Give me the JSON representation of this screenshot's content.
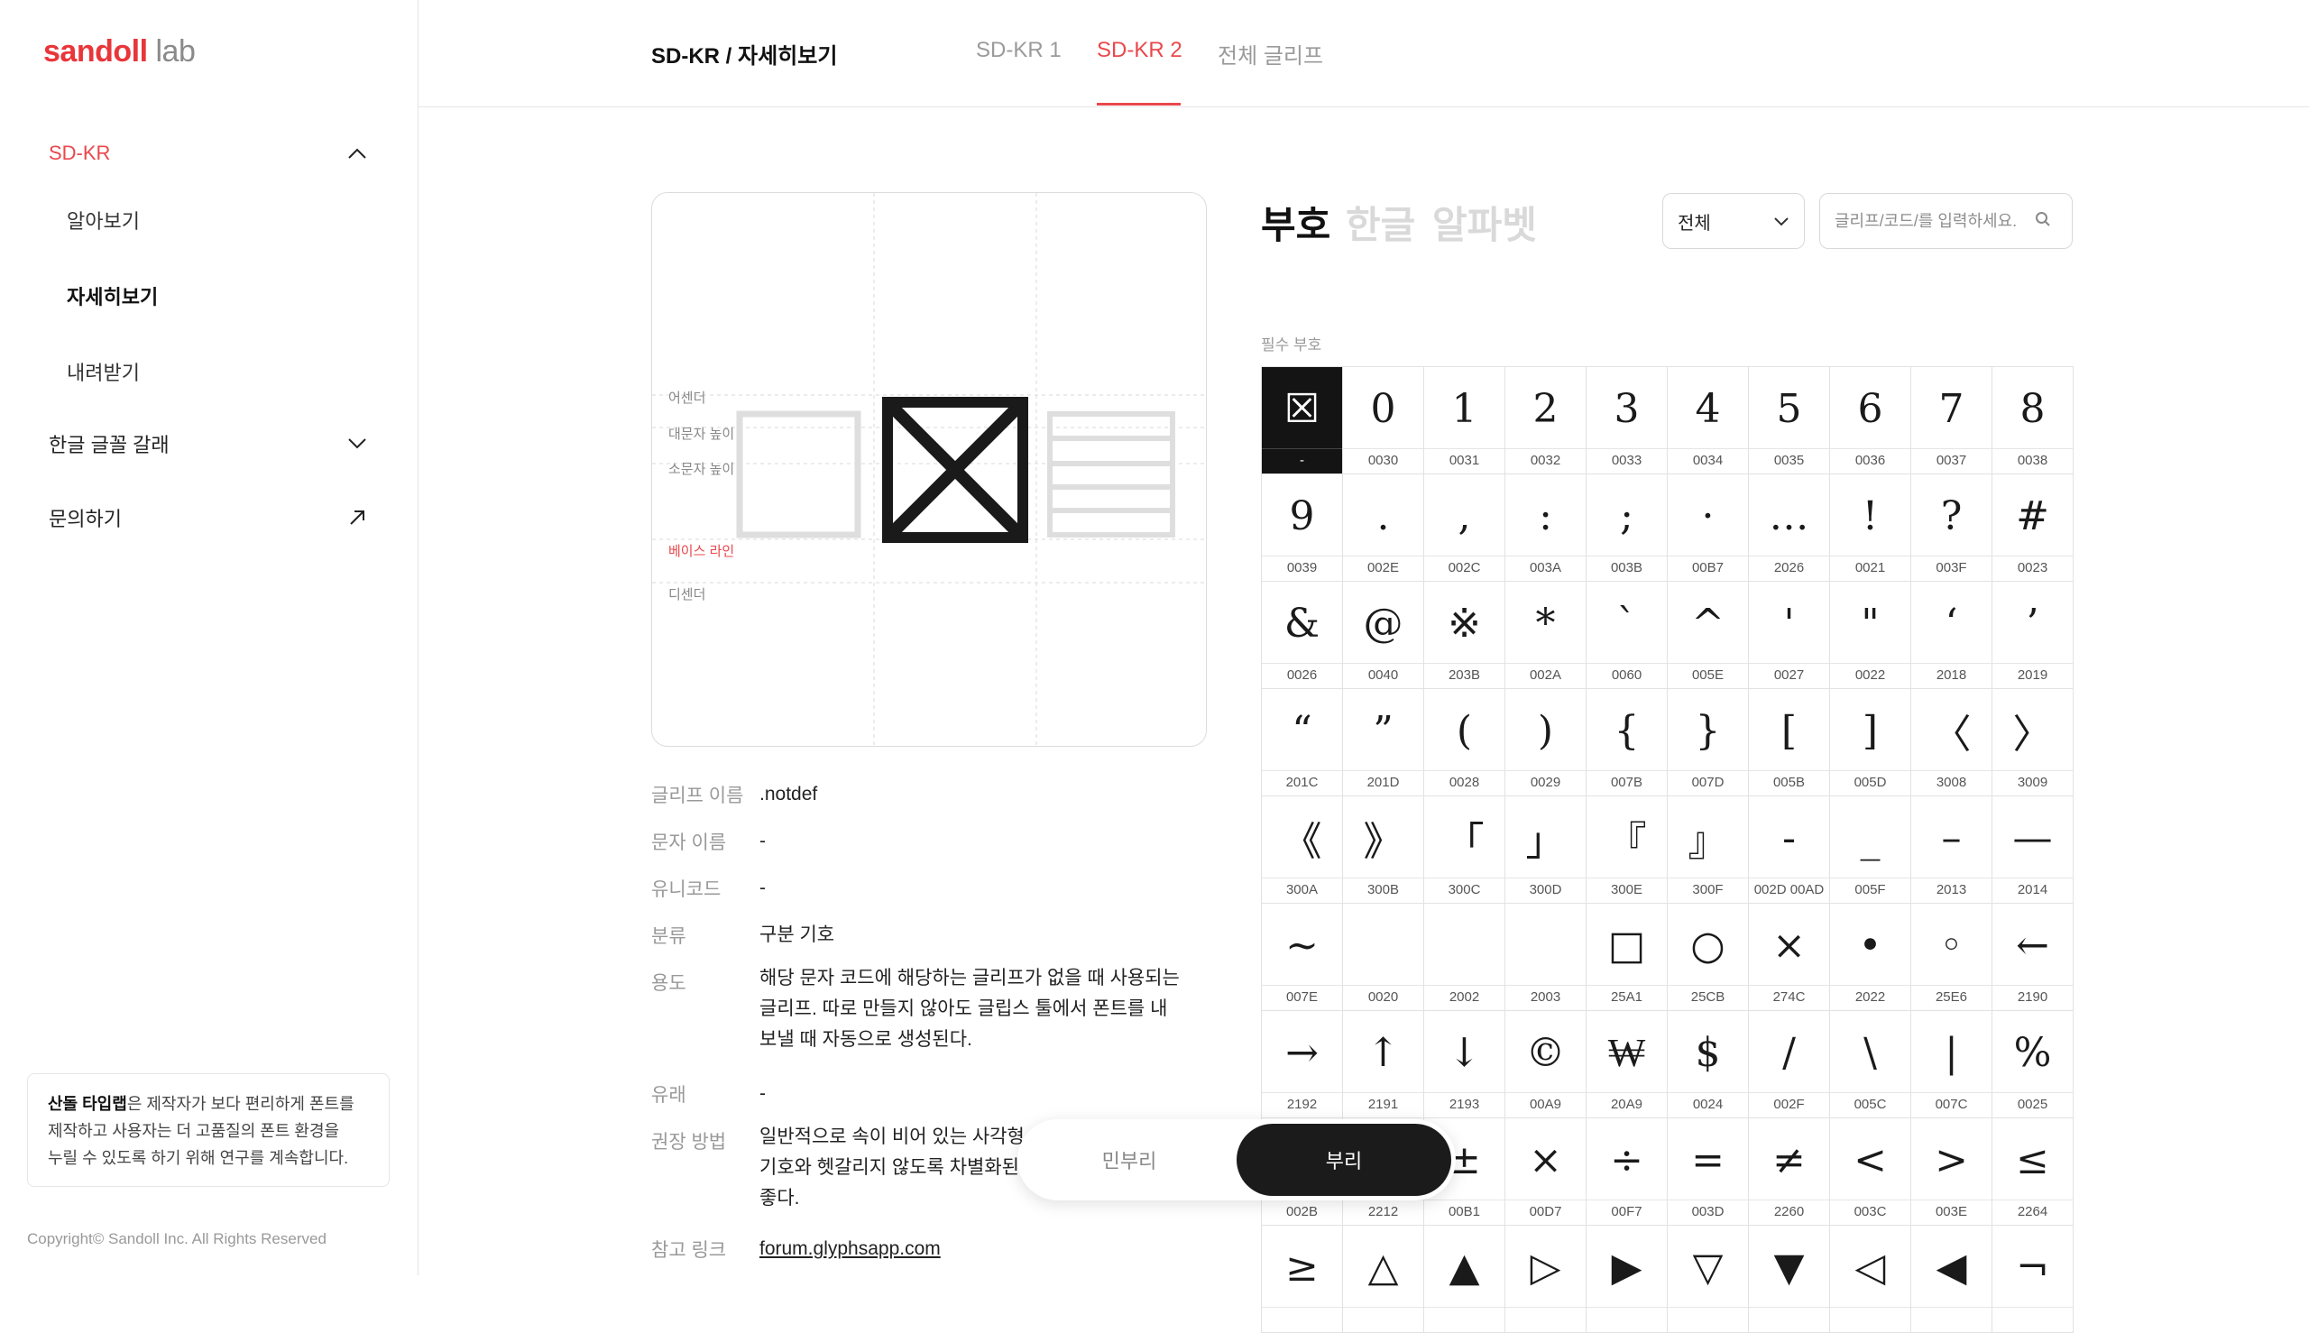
{
  "brand": {
    "name": "sandoll",
    "suffix": "lab",
    "accent": "#e9484c"
  },
  "sidebar": {
    "section": "SD-KR",
    "sub_items": [
      "알아보기",
      "자세히보기",
      "내려받기"
    ],
    "items": [
      "한글 글꼴 갈래",
      "문의하기"
    ],
    "notice_bold": "산돌 타입랩",
    "notice_line1": "은 제작자가 보다 편리하게 폰트를",
    "notice_line2": "제작하고 사용자는 더 고품질의 폰트 환경을",
    "notice_line3": "누릴 수 있도록 하기 위해 연구를 계속합니다.",
    "copyright": "Copyright© Sandoll Inc. All Rights Reserved"
  },
  "header": {
    "breadcrumb": "SD-KR / 자세히보기",
    "tabs": [
      "SD-KR 1",
      "SD-KR 2",
      "전체 글리프"
    ],
    "active_tab": "SD-KR 2"
  },
  "preview": {
    "metrics": [
      "어센더",
      "대문자 높이",
      "소문자 높이",
      "베이스 라인",
      "디센더"
    ]
  },
  "info": [
    {
      "key": "글리프 이름",
      "value": ".notdef"
    },
    {
      "key": "문자 이름",
      "value": "-"
    },
    {
      "key": "유니코드",
      "value": "-"
    },
    {
      "key": "분류",
      "value": "구분 기호"
    },
    {
      "key": "용도",
      "value": "해당 문자 코드에 해당하는 글리프가 없을 때 사용되는 글리프. 따로 만들지 않아도 글립스 툴에서 폰트를 내보낼 때 자동으로 생성된다."
    },
    {
      "key": "유래",
      "value": "-"
    },
    {
      "key": "권장 방법",
      "value": "일반적으로 속이 비어 있는 사각형 기호와 헷갈리지 않도록 차별화된 좋다."
    },
    {
      "key": "참고 링크",
      "value": "forum.glyphsapp.com"
    }
  ],
  "categories": [
    "부호",
    "한글",
    "알파벳"
  ],
  "filter": {
    "selected": "전체"
  },
  "search": {
    "placeholder": "글리프/코드/를 입력하세요."
  },
  "section_label": "필수 부호",
  "glyphs": [
    {
      "g": "☒",
      "c": "-"
    },
    {
      "g": "0",
      "c": "0030"
    },
    {
      "g": "1",
      "c": "0031"
    },
    {
      "g": "2",
      "c": "0032"
    },
    {
      "g": "3",
      "c": "0033"
    },
    {
      "g": "4",
      "c": "0034"
    },
    {
      "g": "5",
      "c": "0035"
    },
    {
      "g": "6",
      "c": "0036"
    },
    {
      "g": "7",
      "c": "0037"
    },
    {
      "g": "8",
      "c": "0038"
    },
    {
      "g": "9",
      "c": "0039"
    },
    {
      "g": ".",
      "c": "002E"
    },
    {
      "g": ",",
      "c": "002C"
    },
    {
      "g": ":",
      "c": "003A"
    },
    {
      "g": ";",
      "c": "003B"
    },
    {
      "g": "·",
      "c": "00B7"
    },
    {
      "g": "…",
      "c": "2026"
    },
    {
      "g": "!",
      "c": "0021"
    },
    {
      "g": "?",
      "c": "003F"
    },
    {
      "g": "#",
      "c": "0023"
    },
    {
      "g": "&",
      "c": "0026"
    },
    {
      "g": "@",
      "c": "0040"
    },
    {
      "g": "※",
      "c": "203B"
    },
    {
      "g": "*",
      "c": "002A"
    },
    {
      "g": "`",
      "c": "0060"
    },
    {
      "g": "^",
      "c": "005E"
    },
    {
      "g": "'",
      "c": "0027"
    },
    {
      "g": "\"",
      "c": "0022"
    },
    {
      "g": "‘",
      "c": "2018"
    },
    {
      "g": "’",
      "c": "2019"
    },
    {
      "g": "“",
      "c": "201C"
    },
    {
      "g": "”",
      "c": "201D"
    },
    {
      "g": "(",
      "c": "0028"
    },
    {
      "g": ")",
      "c": "0029"
    },
    {
      "g": "{",
      "c": "007B"
    },
    {
      "g": "}",
      "c": "007D"
    },
    {
      "g": "[",
      "c": "005B"
    },
    {
      "g": "]",
      "c": "005D"
    },
    {
      "g": "〈",
      "c": "3008"
    },
    {
      "g": "〉",
      "c": "3009"
    },
    {
      "g": "《",
      "c": "300A"
    },
    {
      "g": "》",
      "c": "300B"
    },
    {
      "g": "「",
      "c": "300C"
    },
    {
      "g": "」",
      "c": "300D"
    },
    {
      "g": "『",
      "c": "300E"
    },
    {
      "g": "』",
      "c": "300F"
    },
    {
      "g": "-",
      "c": "002D 00AD"
    },
    {
      "g": "_",
      "c": "005F"
    },
    {
      "g": "–",
      "c": "2013"
    },
    {
      "g": "—",
      "c": "2014"
    },
    {
      "g": "~",
      "c": "007E"
    },
    {
      "g": "",
      "c": "0020"
    },
    {
      "g": "",
      "c": "2002"
    },
    {
      "g": "",
      "c": "2003"
    },
    {
      "g": "□",
      "c": "25A1"
    },
    {
      "g": "○",
      "c": "25CB"
    },
    {
      "g": "×",
      "c": "274C"
    },
    {
      "g": "•",
      "c": "2022"
    },
    {
      "g": "◦",
      "c": "25E6"
    },
    {
      "g": "←",
      "c": "2190"
    },
    {
      "g": "→",
      "c": "2192"
    },
    {
      "g": "↑",
      "c": "2191"
    },
    {
      "g": "↓",
      "c": "2193"
    },
    {
      "g": "©",
      "c": "00A9"
    },
    {
      "g": "₩",
      "c": "20A9"
    },
    {
      "g": "$",
      "c": "0024"
    },
    {
      "g": "/",
      "c": "002F"
    },
    {
      "g": "\\",
      "c": "005C"
    },
    {
      "g": "|",
      "c": "007C"
    },
    {
      "g": "%",
      "c": "0025"
    },
    {
      "g": "+",
      "c": "002B"
    },
    {
      "g": "−",
      "c": "2212"
    },
    {
      "g": "±",
      "c": "00B1"
    },
    {
      "g": "×",
      "c": "00D7"
    },
    {
      "g": "÷",
      "c": "00F7"
    },
    {
      "g": "=",
      "c": "003D"
    },
    {
      "g": "≠",
      "c": "2260"
    },
    {
      "g": "<",
      "c": "003C"
    },
    {
      "g": ">",
      "c": "003E"
    },
    {
      "g": "≤",
      "c": "2264"
    },
    {
      "g": "≥",
      "c": ""
    },
    {
      "g": "△",
      "c": ""
    },
    {
      "g": "▲",
      "c": ""
    },
    {
      "g": "▷",
      "c": ""
    },
    {
      "g": "▶",
      "c": ""
    },
    {
      "g": "▽",
      "c": ""
    },
    {
      "g": "▼",
      "c": ""
    },
    {
      "g": "◁",
      "c": ""
    },
    {
      "g": "◀",
      "c": ""
    },
    {
      "g": "¬",
      "c": ""
    }
  ],
  "toggle": {
    "options": [
      "민부리",
      "부리"
    ],
    "active": "부리"
  }
}
